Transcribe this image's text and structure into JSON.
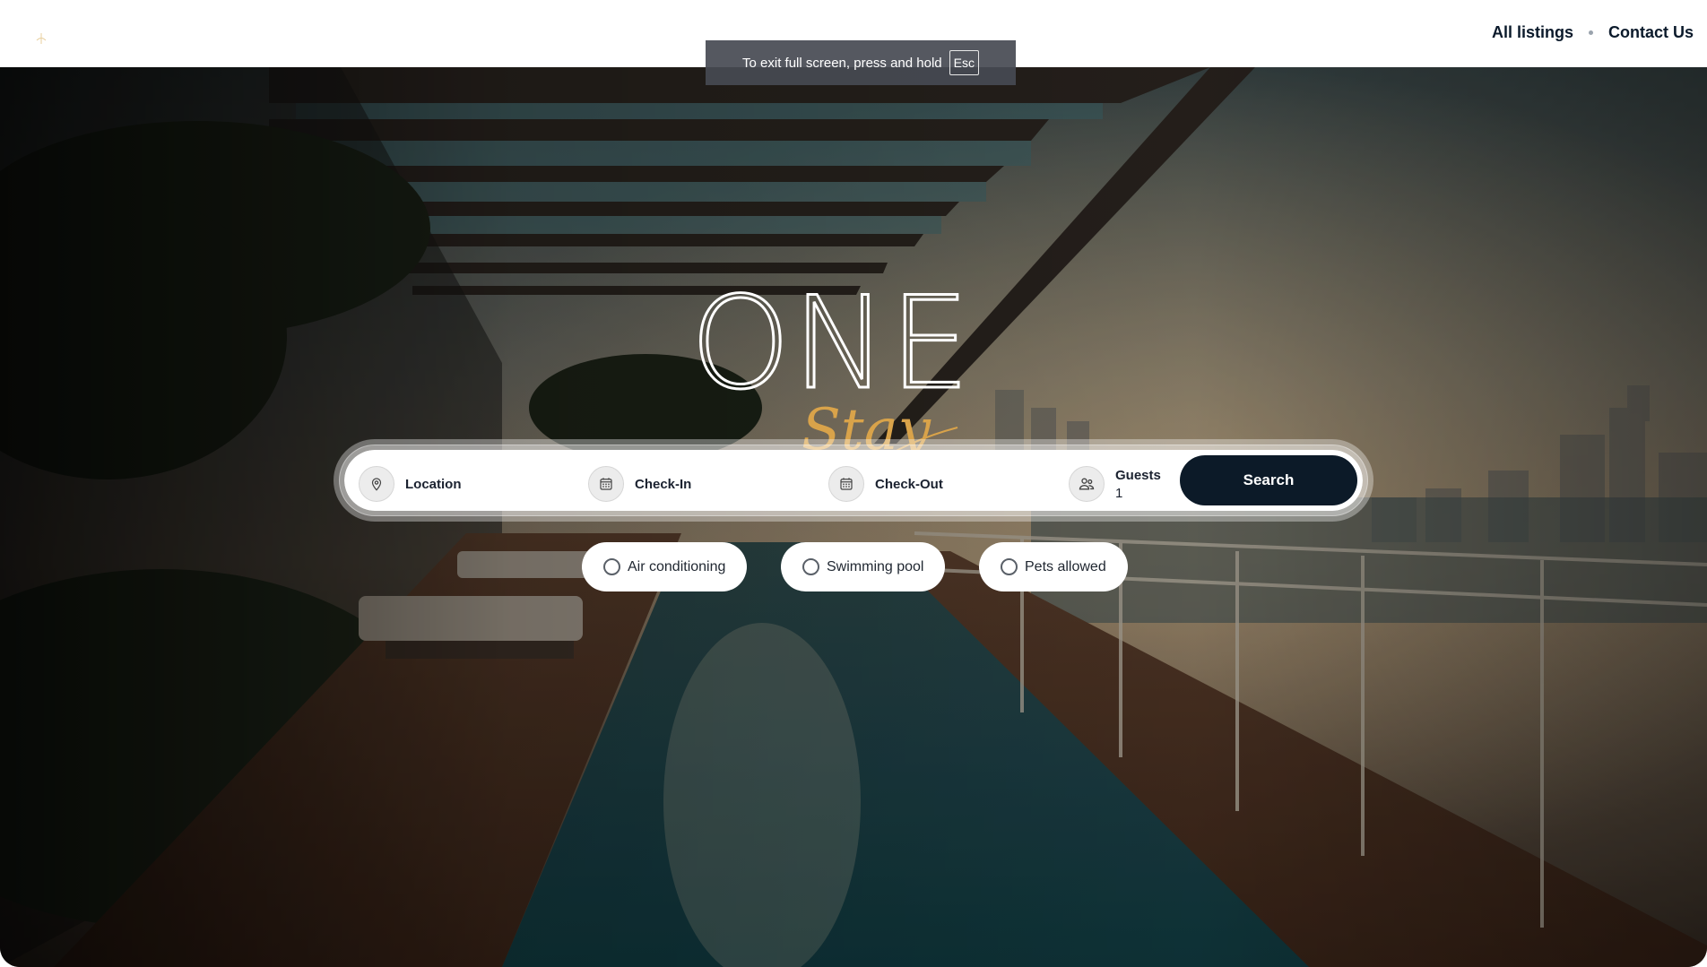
{
  "header": {
    "nav": [
      {
        "label": "All listings"
      },
      {
        "label": "Contact Us"
      }
    ]
  },
  "toast": {
    "text": "To exit full screen, press and hold",
    "key": "Esc"
  },
  "brand": {
    "wordmark": "ONE",
    "script": "Stay"
  },
  "search": {
    "location_label": "Location",
    "checkin_label": "Check-In",
    "checkout_label": "Check-Out",
    "guests_label": "Guests",
    "guests_value": "1",
    "button_label": "Search"
  },
  "filters": [
    {
      "label": "Air conditioning",
      "checked": false
    },
    {
      "label": "Swimming pool",
      "checked": false
    },
    {
      "label": "Pets allowed",
      "checked": false
    }
  ],
  "icons": {
    "location": "map-pin-icon",
    "checkin": "calendar-icon",
    "checkout": "calendar-icon",
    "guests": "users-icon"
  },
  "colors": {
    "navy": "#0c1a28",
    "gold": "#d9a34a"
  }
}
